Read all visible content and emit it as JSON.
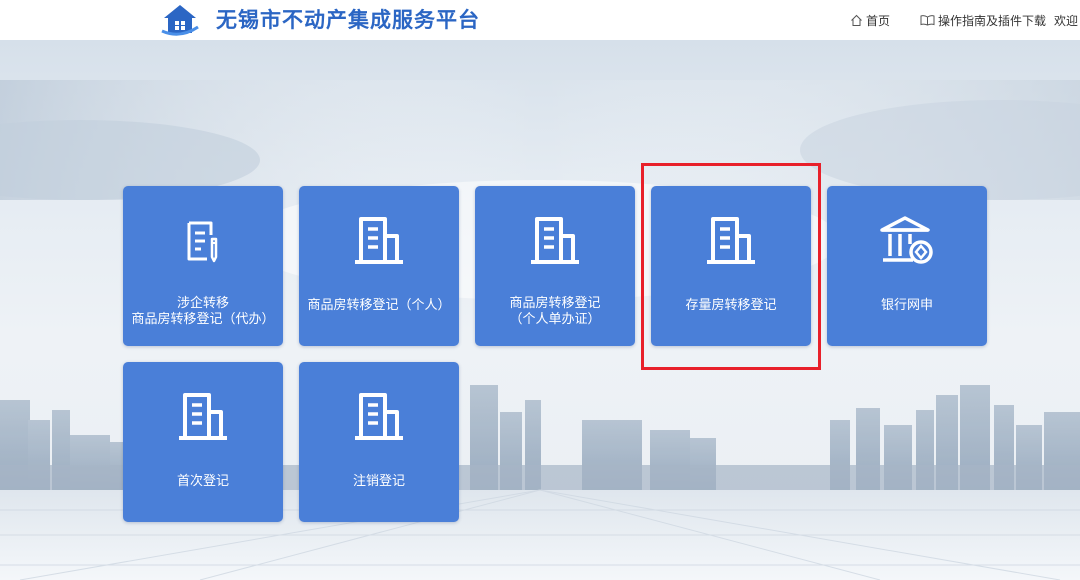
{
  "header": {
    "title": "无锡市不动产集成服务平台",
    "nav": {
      "home": "首页",
      "guide": "操作指南及插件下载",
      "welcome": "欢迎"
    }
  },
  "tiles": [
    {
      "icon": "document-pen-icon",
      "lines": [
        "涉企转移",
        "商品房转移登记（代办）"
      ]
    },
    {
      "icon": "building-icon",
      "lines": [
        "商品房转移登记（个人）"
      ]
    },
    {
      "icon": "building-icon",
      "lines": [
        "商品房转移登记",
        "（个人单办证）"
      ]
    },
    {
      "icon": "building-icon",
      "lines": [
        "存量房转移登记"
      ]
    },
    {
      "icon": "bank-icon",
      "lines": [
        "银行网申"
      ]
    },
    {
      "icon": "building-icon",
      "lines": [
        "首次登记"
      ]
    },
    {
      "icon": "building-icon",
      "lines": [
        "注销登记"
      ]
    }
  ],
  "colors": {
    "tile": "#4a7fd8",
    "title": "#2b66c4",
    "highlight": "#e8202a"
  }
}
